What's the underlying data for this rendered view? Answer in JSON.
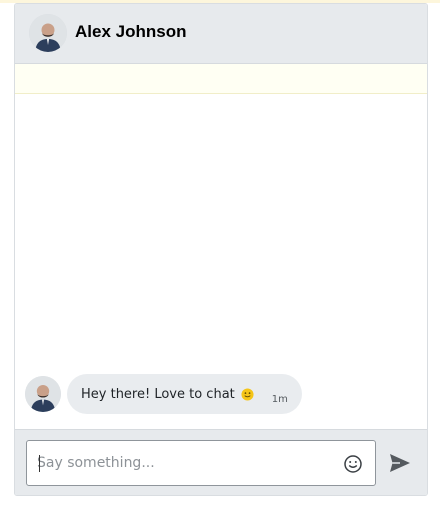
{
  "header": {
    "contact_name": "Alex Johnson",
    "avatar_icon": "user-avatar-icon"
  },
  "messages": [
    {
      "text": "Hey there! Love to chat",
      "emoji": "slightly-smiling-face-icon",
      "time": "1m"
    }
  ],
  "composer": {
    "placeholder": "Say something...",
    "emoji_icon": "smiley-icon",
    "send_icon": "send-icon"
  },
  "colors": {
    "header_bg": "#e7eaed",
    "bubble_bg": "#e9ecef",
    "input_bar_bg": "#e7eaed",
    "send_icon": "#555a5f",
    "emoji_yellow": "#f5c518"
  }
}
